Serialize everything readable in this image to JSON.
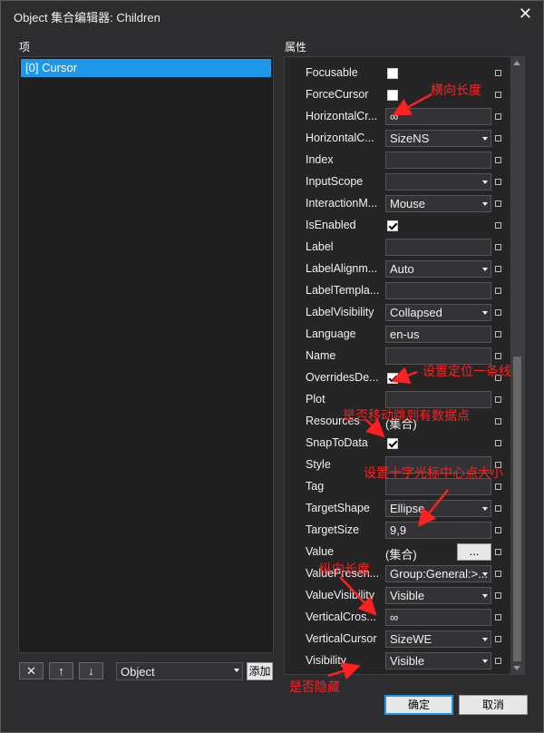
{
  "window": {
    "title": "Object 集合编辑器: Children",
    "close_glyph": "✕"
  },
  "items_label": "项",
  "properties_label": "属性",
  "list": {
    "items": [
      "[0] Cursor"
    ]
  },
  "buttons": {
    "remove": "✕",
    "up": "↑",
    "down": "↓",
    "add": "添加",
    "ok": "确定",
    "cancel": "取消",
    "ellipsis": "..."
  },
  "type_combo": {
    "value": "Object"
  },
  "properties": [
    {
      "name": "Focusable",
      "kind": "checkbox",
      "checked": false
    },
    {
      "name": "ForceCursor",
      "kind": "checkbox",
      "checked": false
    },
    {
      "name": "HorizontalCr...",
      "kind": "text",
      "value": "∞"
    },
    {
      "name": "HorizontalC...",
      "kind": "combo",
      "value": "SizeNS"
    },
    {
      "name": "Index",
      "kind": "text",
      "value": ""
    },
    {
      "name": "InputScope",
      "kind": "combo",
      "value": ""
    },
    {
      "name": "InteractionM...",
      "kind": "combo",
      "value": "Mouse"
    },
    {
      "name": "IsEnabled",
      "kind": "checkbox",
      "checked": true
    },
    {
      "name": "Label",
      "kind": "text",
      "value": ""
    },
    {
      "name": "LabelAlignm...",
      "kind": "combo",
      "value": "Auto"
    },
    {
      "name": "LabelTempla...",
      "kind": "text",
      "value": ""
    },
    {
      "name": "LabelVisibility",
      "kind": "combo",
      "value": "Collapsed"
    },
    {
      "name": "Language",
      "kind": "text",
      "value": "en-us"
    },
    {
      "name": "Name",
      "kind": "text",
      "value": ""
    },
    {
      "name": "OverridesDe...",
      "kind": "checkbox",
      "checked": true
    },
    {
      "name": "Plot",
      "kind": "text",
      "value": ""
    },
    {
      "name": "Resources",
      "kind": "plain",
      "value": "(集合)"
    },
    {
      "name": "SnapToData",
      "kind": "checkbox",
      "checked": true
    },
    {
      "name": "Style",
      "kind": "text",
      "value": ""
    },
    {
      "name": "Tag",
      "kind": "text",
      "value": ""
    },
    {
      "name": "TargetShape",
      "kind": "combo",
      "value": "Ellipse"
    },
    {
      "name": "TargetSize",
      "kind": "text",
      "value": "9,9"
    },
    {
      "name": "Value",
      "kind": "collection",
      "value": "(集合)"
    },
    {
      "name": "ValuePresen...",
      "kind": "combo",
      "value": "Group:General:>..."
    },
    {
      "name": "ValueVisibility",
      "kind": "combo",
      "value": "Visible"
    },
    {
      "name": "VerticalCros...",
      "kind": "text",
      "value": "∞"
    },
    {
      "name": "VerticalCursor",
      "kind": "combo",
      "value": "SizeWE"
    },
    {
      "name": "Visibility",
      "kind": "combo",
      "value": "Visible"
    }
  ],
  "annotations": [
    {
      "text": "横向长度"
    },
    {
      "text": "设置定位一条线"
    },
    {
      "text": "是否移动跳到有数据点"
    },
    {
      "text": "设置十字光标中心点大小"
    },
    {
      "text": "纵向长度"
    },
    {
      "text": "是否隐藏"
    }
  ],
  "colors": {
    "annotation": "#ff2020",
    "selection": "#1c97ea",
    "background": "#2d2d30"
  }
}
